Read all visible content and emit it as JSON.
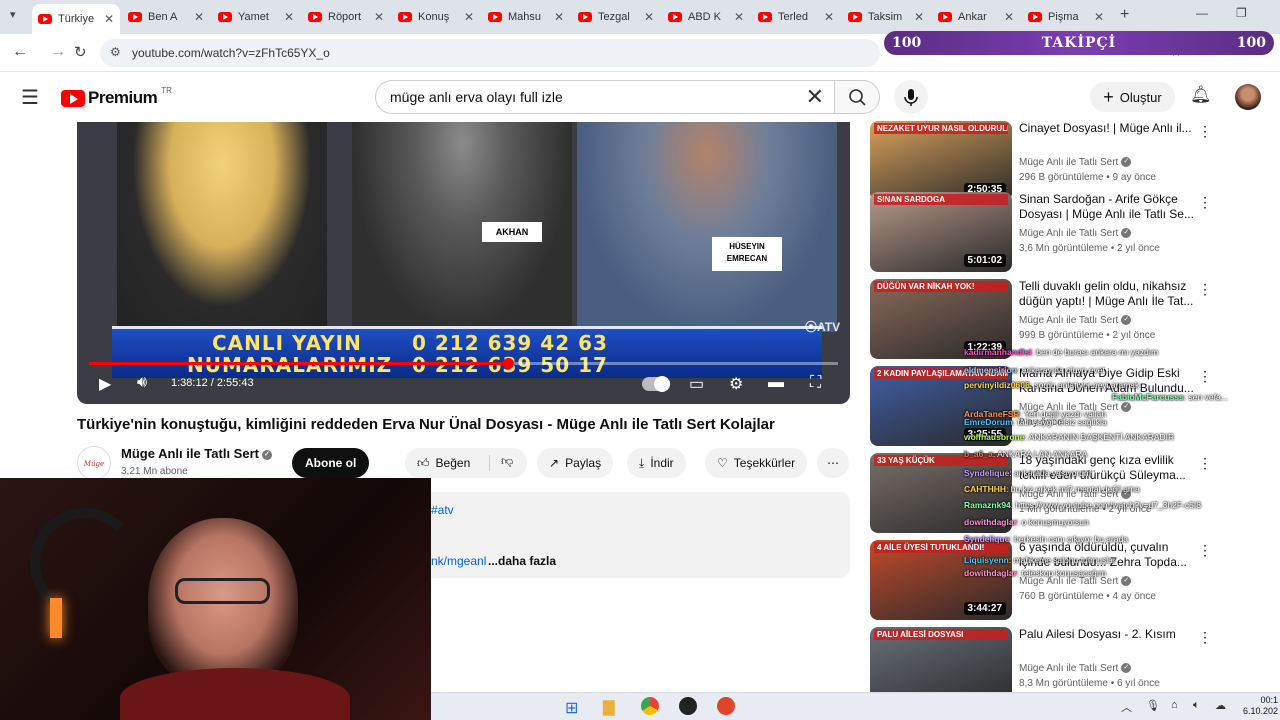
{
  "browser": {
    "tabs": [
      {
        "label": "Türkiye",
        "active": true
      },
      {
        "label": "Ben A"
      },
      {
        "label": "Yamet"
      },
      {
        "label": "Röport"
      },
      {
        "label": "Konuş"
      },
      {
        "label": "Mahsu"
      },
      {
        "label": "Tezgal"
      },
      {
        "label": "ABD K"
      },
      {
        "label": "Terled"
      },
      {
        "label": "Taksim"
      },
      {
        "label": "Ankar"
      },
      {
        "label": "Pişma"
      }
    ],
    "url": "youtube.com/watch?v=zFhTc65YX_o"
  },
  "follower_overlay": {
    "left": "100",
    "label": "TAKİPÇİ",
    "right": "100"
  },
  "youtube": {
    "logo_text": "Premium",
    "logo_sup": "TR",
    "search_value": "müge anlı erva olayı full izle",
    "create_label": "Oluştur"
  },
  "video": {
    "lower_third_line1": "CANLI YAYIN",
    "lower_third_number1": "0 212 639 42 63",
    "lower_third_line2": "NUMARALARIMIZ",
    "lower_third_number2": "0 212 639 50 17",
    "name_tag_1": "HÜSEYIN EMRECAN",
    "name_tag_2": "AKHAN",
    "time_display": "1:38:12 / 2:55:43",
    "progress_fraction": 0.56,
    "title": "Türkiye'nin konuştuğu, kimliğini reddeden Erva Nur Ünal Dosyası - Müge Anlı ile Tatlı Sert Kolajlar"
  },
  "channel": {
    "name": "Müge Anlı ile Tatlı Sert",
    "subscribers": "3,21 Mn abone",
    "subscribe_label": "Abone ol",
    "avatar_text": "Müge Anlı"
  },
  "actions": {
    "like": "Beğen",
    "share": "Paylaş",
    "download": "İndir",
    "thanks": "Teşekkürler"
  },
  "description": {
    "hashtag": "#atv",
    "link": "nk/mgeanl",
    "more": "...daha fazla"
  },
  "recommended": [
    {
      "title": "Cinayet Dosyası! | Müge Anlı il...",
      "channel": "Müge Anlı ile Tatlı Sert",
      "meta": "296 B görüntüleme • 9 ay önce",
      "duration": "2:50:35",
      "thumb_text": "NEZAKET UYUR NASIL OLDURULDU?",
      "thumb_color": "#d9a15a"
    },
    {
      "title": "Sinan Sardoğan - Arife Gökçe Dosyası | Müge Anlı ile Tatlı Se...",
      "channel": "Müge Anlı ile Tatlı Sert",
      "meta": "3,6 Mn görüntüleme • 2 yıl önce",
      "duration": "5:01:02",
      "thumb_text": "SINAN SARDOGA",
      "thumb_color": "#b89a8a"
    },
    {
      "title": "Telli duvaklı gelin oldu, nikahsız düğün yaptı! | Müge Anlı İle Tat...",
      "channel": "Müge Anlı ile Tatlı Sert",
      "meta": "999 B görüntüleme • 2 yıl önce",
      "duration": "1:22:39",
      "thumb_text": "DÜĞÜN VAR NİKAH YOK!",
      "thumb_color": "#8c6a5a"
    },
    {
      "title": "Mama Almaya Diye Gidip Eski Karısına Dönen Adam Bulundu...",
      "channel": "Müge Anlı ile Tatlı Sert",
      "meta": "8 ay önce",
      "duration": "3:25:55",
      "thumb_text": "2 KADIN PAYLAŞILAMAYAN ADAM!",
      "thumb_color": "#3f5fa8"
    },
    {
      "title": "18 yaşındaki genç kıza evlilik teklifi eden üfürükçü Süleyma...",
      "channel": "Müge Anlı ile Tatlı Sert",
      "meta": "1 Mn görüntüleme • 2 yıl önce",
      "duration": "",
      "thumb_text": "33 YAŞ KÜÇÜK",
      "thumb_color": "#7a6f6a"
    },
    {
      "title": "6 yaşında öldürüldü, çuvalın içinde bulundu... Zehra Topda...",
      "channel": "Müge Anlı ile Tatlı Sert",
      "meta": "760 B görüntüleme • 4 ay önce",
      "duration": "3:44:27",
      "thumb_text": "4 AİLE ÜYESİ TUTUKLANDI!",
      "thumb_color": "#c24a2a"
    },
    {
      "title": "Palu Ailesi Dosyası - 2. Kısım",
      "channel": "Müge Anlı ile Tatlı Sert",
      "meta": "8,3 Mn görüntüleme • 6 yıl önce",
      "duration": "",
      "thumb_text": "PALU AİLESİ DOSYASI",
      "thumb_color": "#6a6f7a"
    }
  ],
  "chat": [
    {
      "user": "kadirmanhandlsi",
      "text": ": ben de burası ankara mı yazdım",
      "color": "#ff4fd8"
    },
    {
      "user": "eldmensirion",
      "text": ": ankarayıda oluyo evet",
      "color": "#9ad0ff"
    },
    {
      "user": "pervinyildiz0606",
      "text": ": sordu anlatıyor neyi aramak",
      "color": "#ffd34f"
    },
    {
      "user": "FabioMcFarcusss",
      "text": ": sen vefa...",
      "color": "#7fffb0"
    },
    {
      "user": "ArdaTaneFSR",
      "text": ": Yeri değil yazdı vallah",
      "color": "#ff8f4f"
    },
    {
      "user": "EmreDorum",
      "text": ": tatlı saygı telsiz sağlıkla",
      "color": "#4fc3ff"
    },
    {
      "user": "wolfhausbrone",
      "text": ": ANKARANIN BAŞKENTİ ANKARADIR",
      "color": "#b4ff4f"
    },
    {
      "user": "b_a6_a",
      "text": ": ANKARA LAN ANKARA",
      "color": "#ff6f6f"
    },
    {
      "user": "Syndelique",
      "text": ": ankarada yaşıyorum",
      "color": "#c59bff"
    },
    {
      "user": "CAHTHHH",
      "text": ": bu kız erkek mi? mental değil ama",
      "color": "#ffd34f"
    },
    {
      "user": "Ramaznk94",
      "text": ": https://www.youtube.com/watch?v=d7_3h2F-c5I8",
      "color": "#7fffb0"
    },
    {
      "user": "dowithdaglar",
      "text": ": o konuşmuyorsun",
      "color": "#ff8fd8"
    },
    {
      "user": "Syndelique",
      "text": ": herkesin canı çıkıyor bu arada",
      "color": "#c59bff"
    },
    {
      "user": "Liquisyenn",
      "text": ": mahkeme salonu tutmuşlar",
      "color": "#4fc3ff"
    },
    {
      "user": "dowithdaglar",
      "text": ": teleskop konuşacağım",
      "color": "#ff8fd8"
    }
  ],
  "taskbar": {
    "time": "00:1",
    "date": "6.10.202"
  },
  "colors": {
    "youtube_red": "#ff0000",
    "follower_purple": "#6a35a0",
    "lower_third_blue": "#1e4fc2"
  }
}
